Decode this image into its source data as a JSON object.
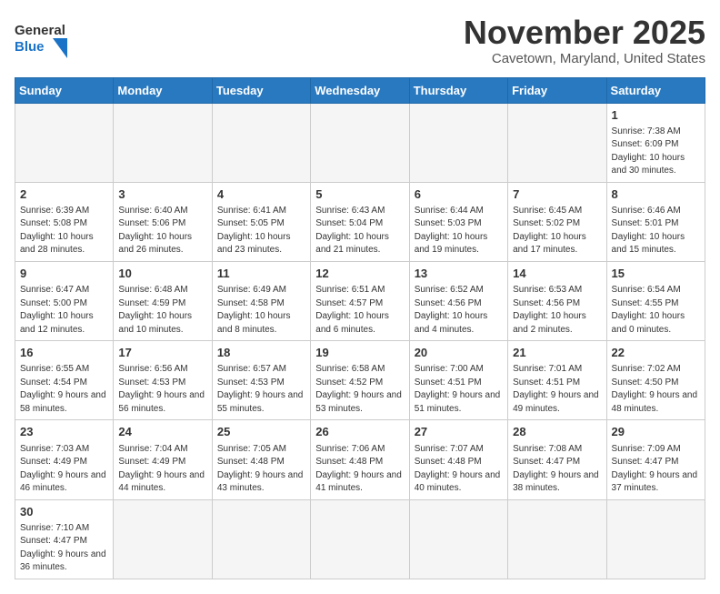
{
  "header": {
    "logo_general": "General",
    "logo_blue": "Blue",
    "month_title": "November 2025",
    "location": "Cavetown, Maryland, United States"
  },
  "weekdays": [
    "Sunday",
    "Monday",
    "Tuesday",
    "Wednesday",
    "Thursday",
    "Friday",
    "Saturday"
  ],
  "weeks": [
    [
      {
        "day": "",
        "info": ""
      },
      {
        "day": "",
        "info": ""
      },
      {
        "day": "",
        "info": ""
      },
      {
        "day": "",
        "info": ""
      },
      {
        "day": "",
        "info": ""
      },
      {
        "day": "",
        "info": ""
      },
      {
        "day": "1",
        "info": "Sunrise: 7:38 AM\nSunset: 6:09 PM\nDaylight: 10 hours and 30 minutes."
      }
    ],
    [
      {
        "day": "2",
        "info": "Sunrise: 6:39 AM\nSunset: 5:08 PM\nDaylight: 10 hours and 28 minutes."
      },
      {
        "day": "3",
        "info": "Sunrise: 6:40 AM\nSunset: 5:06 PM\nDaylight: 10 hours and 26 minutes."
      },
      {
        "day": "4",
        "info": "Sunrise: 6:41 AM\nSunset: 5:05 PM\nDaylight: 10 hours and 23 minutes."
      },
      {
        "day": "5",
        "info": "Sunrise: 6:43 AM\nSunset: 5:04 PM\nDaylight: 10 hours and 21 minutes."
      },
      {
        "day": "6",
        "info": "Sunrise: 6:44 AM\nSunset: 5:03 PM\nDaylight: 10 hours and 19 minutes."
      },
      {
        "day": "7",
        "info": "Sunrise: 6:45 AM\nSunset: 5:02 PM\nDaylight: 10 hours and 17 minutes."
      },
      {
        "day": "8",
        "info": "Sunrise: 6:46 AM\nSunset: 5:01 PM\nDaylight: 10 hours and 15 minutes."
      }
    ],
    [
      {
        "day": "9",
        "info": "Sunrise: 6:47 AM\nSunset: 5:00 PM\nDaylight: 10 hours and 12 minutes."
      },
      {
        "day": "10",
        "info": "Sunrise: 6:48 AM\nSunset: 4:59 PM\nDaylight: 10 hours and 10 minutes."
      },
      {
        "day": "11",
        "info": "Sunrise: 6:49 AM\nSunset: 4:58 PM\nDaylight: 10 hours and 8 minutes."
      },
      {
        "day": "12",
        "info": "Sunrise: 6:51 AM\nSunset: 4:57 PM\nDaylight: 10 hours and 6 minutes."
      },
      {
        "day": "13",
        "info": "Sunrise: 6:52 AM\nSunset: 4:56 PM\nDaylight: 10 hours and 4 minutes."
      },
      {
        "day": "14",
        "info": "Sunrise: 6:53 AM\nSunset: 4:56 PM\nDaylight: 10 hours and 2 minutes."
      },
      {
        "day": "15",
        "info": "Sunrise: 6:54 AM\nSunset: 4:55 PM\nDaylight: 10 hours and 0 minutes."
      }
    ],
    [
      {
        "day": "16",
        "info": "Sunrise: 6:55 AM\nSunset: 4:54 PM\nDaylight: 9 hours and 58 minutes."
      },
      {
        "day": "17",
        "info": "Sunrise: 6:56 AM\nSunset: 4:53 PM\nDaylight: 9 hours and 56 minutes."
      },
      {
        "day": "18",
        "info": "Sunrise: 6:57 AM\nSunset: 4:53 PM\nDaylight: 9 hours and 55 minutes."
      },
      {
        "day": "19",
        "info": "Sunrise: 6:58 AM\nSunset: 4:52 PM\nDaylight: 9 hours and 53 minutes."
      },
      {
        "day": "20",
        "info": "Sunrise: 7:00 AM\nSunset: 4:51 PM\nDaylight: 9 hours and 51 minutes."
      },
      {
        "day": "21",
        "info": "Sunrise: 7:01 AM\nSunset: 4:51 PM\nDaylight: 9 hours and 49 minutes."
      },
      {
        "day": "22",
        "info": "Sunrise: 7:02 AM\nSunset: 4:50 PM\nDaylight: 9 hours and 48 minutes."
      }
    ],
    [
      {
        "day": "23",
        "info": "Sunrise: 7:03 AM\nSunset: 4:49 PM\nDaylight: 9 hours and 46 minutes."
      },
      {
        "day": "24",
        "info": "Sunrise: 7:04 AM\nSunset: 4:49 PM\nDaylight: 9 hours and 44 minutes."
      },
      {
        "day": "25",
        "info": "Sunrise: 7:05 AM\nSunset: 4:48 PM\nDaylight: 9 hours and 43 minutes."
      },
      {
        "day": "26",
        "info": "Sunrise: 7:06 AM\nSunset: 4:48 PM\nDaylight: 9 hours and 41 minutes."
      },
      {
        "day": "27",
        "info": "Sunrise: 7:07 AM\nSunset: 4:48 PM\nDaylight: 9 hours and 40 minutes."
      },
      {
        "day": "28",
        "info": "Sunrise: 7:08 AM\nSunset: 4:47 PM\nDaylight: 9 hours and 38 minutes."
      },
      {
        "day": "29",
        "info": "Sunrise: 7:09 AM\nSunset: 4:47 PM\nDaylight: 9 hours and 37 minutes."
      }
    ],
    [
      {
        "day": "30",
        "info": "Sunrise: 7:10 AM\nSunset: 4:47 PM\nDaylight: 9 hours and 36 minutes."
      },
      {
        "day": "",
        "info": ""
      },
      {
        "day": "",
        "info": ""
      },
      {
        "day": "",
        "info": ""
      },
      {
        "day": "",
        "info": ""
      },
      {
        "day": "",
        "info": ""
      },
      {
        "day": "",
        "info": ""
      }
    ]
  ]
}
